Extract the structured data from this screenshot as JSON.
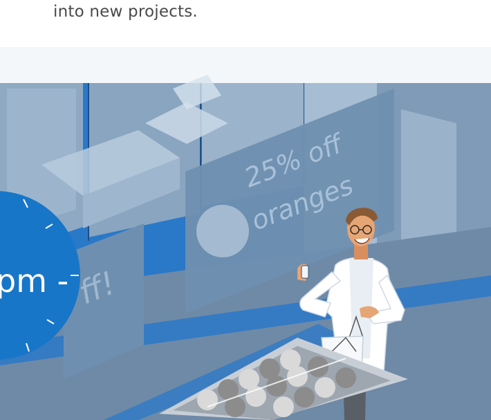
{
  "intro": {
    "text": "into new projects."
  },
  "illustration": {
    "sign_text_line1": "25% off",
    "sign_text_line2": "oranges",
    "left_sign_text": "ff!",
    "clock_text": "pm -"
  },
  "colors": {
    "wall_dark": "#1e6fc3",
    "panel_grey": "#7d98b4",
    "panel_light": "#a7bfd6",
    "clock_blue": "#1876c8",
    "sign_grey": "#6f8fb0"
  },
  "icons": [
    "clock-icon",
    "shopping-bag-icon",
    "smartphone-icon"
  ]
}
